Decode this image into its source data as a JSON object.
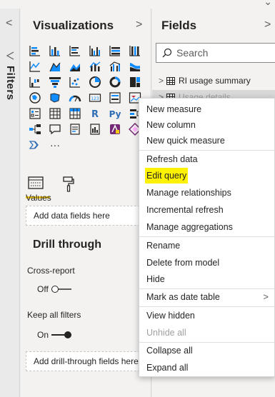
{
  "top": {
    "chevron": "⌄"
  },
  "filters": {
    "collapse_icon": "<",
    "label": "Filters"
  },
  "visualizations": {
    "title": "Visualizations",
    "expand_icon": ">",
    "more_label": "···",
    "values_label": "Values",
    "values_placeholder": "Add data fields here",
    "drill_title": "Drill through",
    "cross_report_label": "Cross-report",
    "cross_report_state": "Off",
    "keep_filters_label": "Keep all filters",
    "keep_filters_state": "On",
    "drill_placeholder": "Add drill-through fields here",
    "accent_color": "#f2c811"
  },
  "fields": {
    "title": "Fields",
    "expand_icon": ">",
    "search_placeholder": "Search",
    "tables": [
      {
        "name": "RI usage summary"
      },
      {
        "name": "Usage details"
      }
    ]
  },
  "context_menu": {
    "items": [
      {
        "label": "New measure"
      },
      {
        "label": "New column"
      },
      {
        "label": "New quick measure"
      },
      {
        "label": "Refresh data"
      },
      {
        "label": "Edit query"
      },
      {
        "label": "Manage relationships"
      },
      {
        "label": "Incremental refresh"
      },
      {
        "label": "Manage aggregations"
      },
      {
        "label": "Rename"
      },
      {
        "label": "Delete from model"
      },
      {
        "label": "Hide"
      },
      {
        "label": "Mark as date table"
      },
      {
        "label": "View hidden"
      },
      {
        "label": "Unhide all"
      },
      {
        "label": "Collapse all"
      },
      {
        "label": "Expand all"
      }
    ],
    "highlight_color": "#fff200",
    "submenu_icon": ">"
  }
}
